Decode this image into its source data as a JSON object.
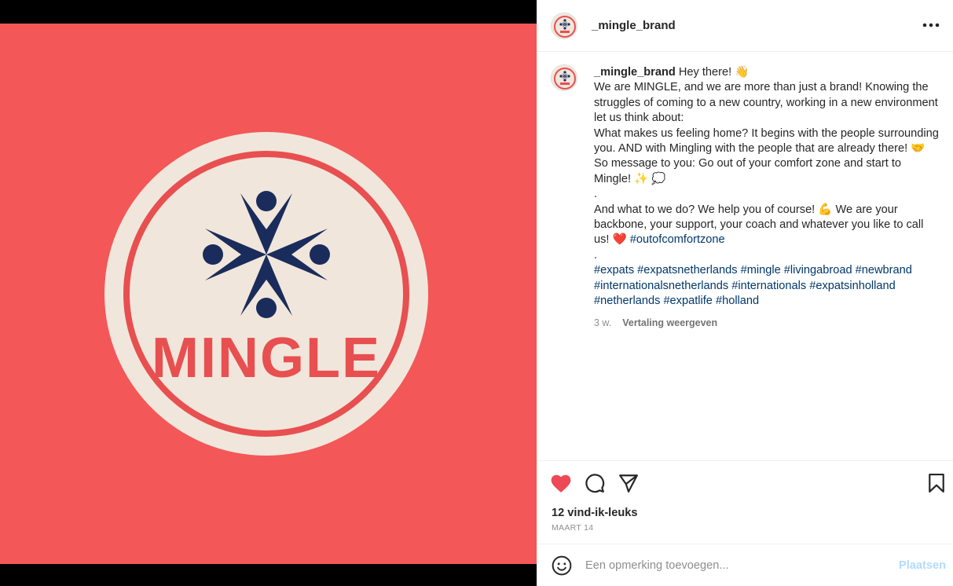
{
  "media": {
    "brand_text": "MINGLE",
    "colors": {
      "background": "#f45757",
      "cream": "#f1e6db",
      "ring": "#e84f50",
      "navy": "#1a2c5b"
    }
  },
  "post": {
    "username": "_mingle_brand",
    "caption": {
      "greeting": "Hey there! 👋",
      "lines": [
        "We are MINGLE, and we are more than just a brand! Knowing the struggles of coming to a new country, working in a new environment let us think about:",
        "What makes us feeling home? It begins with the people surrounding you. AND with Mingling with the people that are already there! 🤝",
        "So message to you: Go out of your comfort zone and start to Mingle! ✨ 💭",
        ".",
        "And what to we do? We help you of course! 💪 We are your backbone, your support, your coach and whatever you like to call us! ❤️"
      ],
      "inline_tag": "#outofcomfortzone",
      "dot": ".",
      "hashtags": "#expats #expatsnetherlands #mingle #livingabroad #newbrand #internationalsnetherlands #internationals #expatsinholland #netherlands #expatlife #holland"
    },
    "age": "3 w.",
    "translate_label": "Vertaling weergeven",
    "likes_text": "12 vind-ik-leuks",
    "date": "MAART 14",
    "comment_placeholder": "Een opmerking toevoegen...",
    "post_button": "Plaatsen"
  },
  "icons": {
    "like": "heart-filled-icon",
    "comment": "comment-icon",
    "share": "send-icon",
    "save": "bookmark-icon",
    "emoji": "smiley-icon",
    "more": "more-options-icon"
  },
  "colors": {
    "like_red": "#ed4956",
    "link_blue": "#00376b",
    "post_disabled": "#b3dbff"
  }
}
